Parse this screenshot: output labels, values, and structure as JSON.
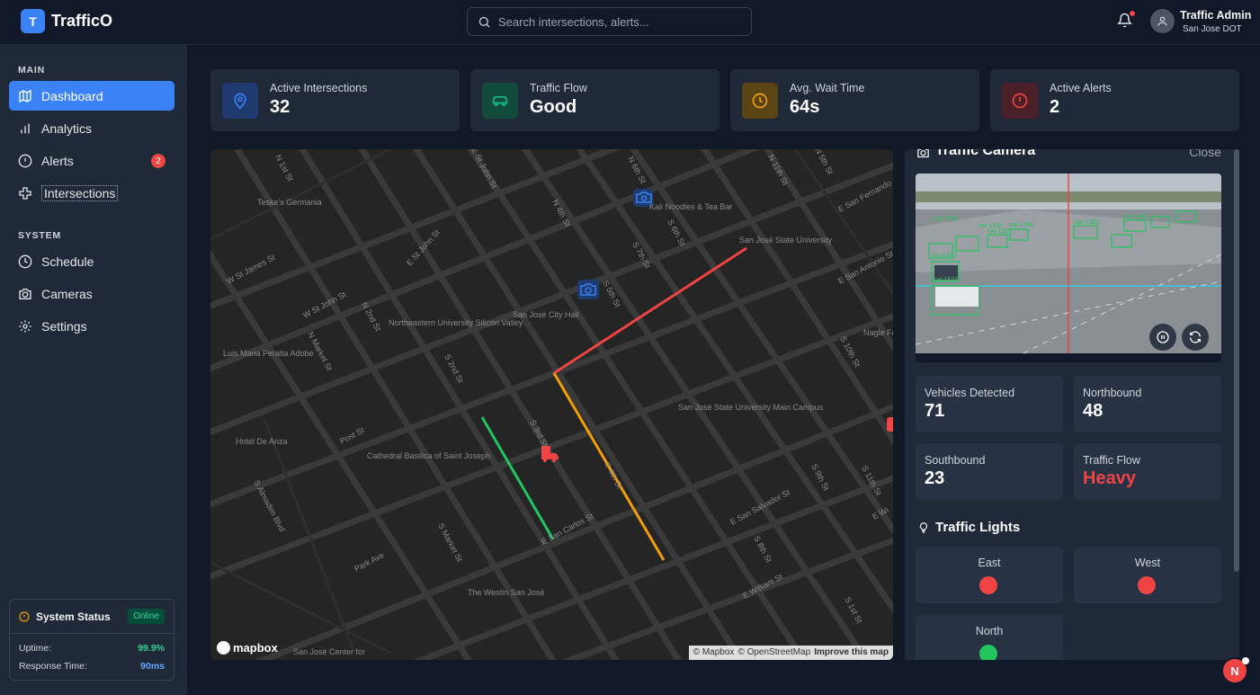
{
  "header": {
    "logo_letter": "T",
    "app_name": "TrafficO",
    "search_placeholder": "Search intersections, alerts...",
    "user_name": "Traffic Admin",
    "user_org": "San Jose DOT"
  },
  "sidebar": {
    "main_label": "MAIN",
    "system_label": "SYSTEM",
    "main_items": [
      {
        "label": "Dashboard",
        "icon": "map-icon"
      },
      {
        "label": "Analytics",
        "icon": "bar-chart-icon"
      },
      {
        "label": "Alerts",
        "icon": "alert-circle-icon",
        "badge": "2"
      },
      {
        "label": "Intersections",
        "icon": "crossroads-icon"
      }
    ],
    "system_items": [
      {
        "label": "Schedule",
        "icon": "clock-icon"
      },
      {
        "label": "Cameras",
        "icon": "camera-icon"
      },
      {
        "label": "Settings",
        "icon": "gear-icon"
      }
    ],
    "status": {
      "title": "System Status",
      "badge": "Online",
      "uptime_label": "Uptime:",
      "uptime_value": "99.9%",
      "response_label": "Response Time:",
      "response_value": "90ms"
    }
  },
  "stats": [
    {
      "label": "Active Intersections",
      "value": "32",
      "icon": "location-pin-icon",
      "color": "#3b82f6"
    },
    {
      "label": "Traffic Flow",
      "value": "Good",
      "icon": "car-icon",
      "color": "#10b981"
    },
    {
      "label": "Avg. Wait Time",
      "value": "64s",
      "icon": "clock-icon",
      "color": "#f59e0b"
    },
    {
      "label": "Active Alerts",
      "value": "2",
      "icon": "alert-circle-icon",
      "color": "#ef4444"
    }
  ],
  "map": {
    "labels": [
      "Teske's Germania",
      "E St John St",
      "W St James St",
      "W St John St",
      "N 1st St",
      "N 2nd St",
      "Northeastern University Silicon Valley",
      "San José City Hall",
      "Luis Maria Peralta Adobe",
      "N Market St",
      "S 2nd St",
      "S 3rd St",
      "S 4th St",
      "S 5th St",
      "S 6th St",
      "S 7th St",
      "S 10th St",
      "Nagle Fe",
      "Post St",
      "Cathedral Basilica of Saint Joseph",
      "Hotel De Anza",
      "S Almaden Blvd",
      "Park Ave",
      "S Market St",
      "E San Carlos St",
      "E San Salvador St",
      "E William St",
      "The Westin San José",
      "San José Center for",
      "Kali Noodles & Tea Bar",
      "San José State University",
      "San José State University Main Campus",
      "E San Fernando",
      "E San Antonio St",
      "N 4th St",
      "N 6th St",
      "N 11th St",
      "S 11th St",
      "S 9th St",
      "S 8th St",
      "E St John St",
      "N 5th St",
      "S 1st St",
      "E Wi"
    ],
    "mapbox_logo": "mapbox",
    "attribution": [
      "© Mapbox",
      "© OpenStreetMap",
      "Improve this map"
    ],
    "route_colors": {
      "heavy": "#ef4444",
      "moderate": "#f59e0b",
      "light": "#22c55e"
    }
  },
  "camera": {
    "title": "Traffic Camera",
    "close_label": "Close",
    "overlay_labels": [
      "car 1501",
      "car 1431",
      "car 1361",
      "car 1362",
      "car 1367",
      "car 1400",
      "car 1521",
      "car 1480"
    ],
    "metrics": [
      {
        "label": "Vehicles Detected",
        "value": "71",
        "color": "#ffffff"
      },
      {
        "label": "Northbound",
        "value": "48",
        "color": "#ffffff"
      },
      {
        "label": "Southbound",
        "value": "23",
        "color": "#ffffff"
      },
      {
        "label": "Traffic Flow",
        "value": "Heavy",
        "color": "#ef4444"
      }
    ]
  },
  "lights": {
    "title": "Traffic Lights",
    "items": [
      {
        "label": "East",
        "color": "#ef4444"
      },
      {
        "label": "West",
        "color": "#ef4444"
      },
      {
        "label": "North",
        "color": "#22c55e"
      }
    ]
  },
  "fab": {
    "label": "N"
  }
}
